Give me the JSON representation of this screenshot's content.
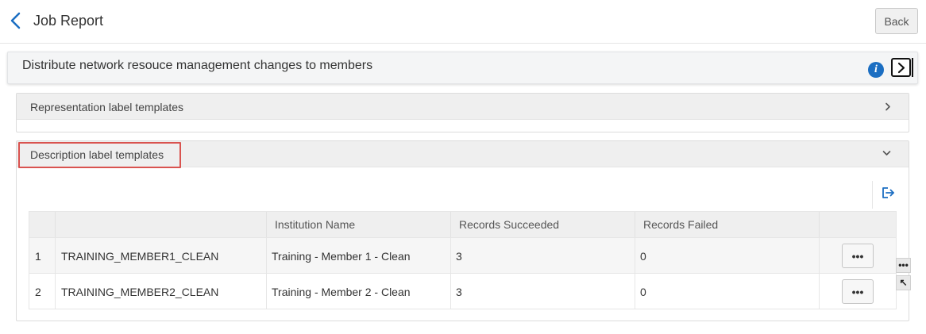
{
  "page": {
    "title": "Job Report",
    "back_label": "Back"
  },
  "job": {
    "title": "Distribute network resouce management changes to members"
  },
  "sections": [
    {
      "label": "Representation label templates",
      "expanded": false
    },
    {
      "label": "Description label templates",
      "expanded": true
    }
  ],
  "table": {
    "headers": [
      "",
      "",
      "Institution Name",
      "Records Succeeded",
      "Records Failed",
      ""
    ],
    "rows": [
      {
        "index": "1",
        "code": "TRAINING_MEMBER1_CLEAN",
        "institution": "Training - Member 1 - Clean",
        "succeeded": "3",
        "failed": "0",
        "actions_label": "•••"
      },
      {
        "index": "2",
        "code": "TRAINING_MEMBER2_CLEAN",
        "institution": "Training - Member 2 - Clean",
        "succeeded": "3",
        "failed": "0",
        "actions_label": "•••"
      }
    ]
  },
  "side_tools": {
    "more_label": "•••",
    "resize_label": "↖"
  },
  "info_icon_glyph": "i",
  "colors": {
    "accent": "#1b6ec2",
    "highlight": "#d9534f"
  }
}
